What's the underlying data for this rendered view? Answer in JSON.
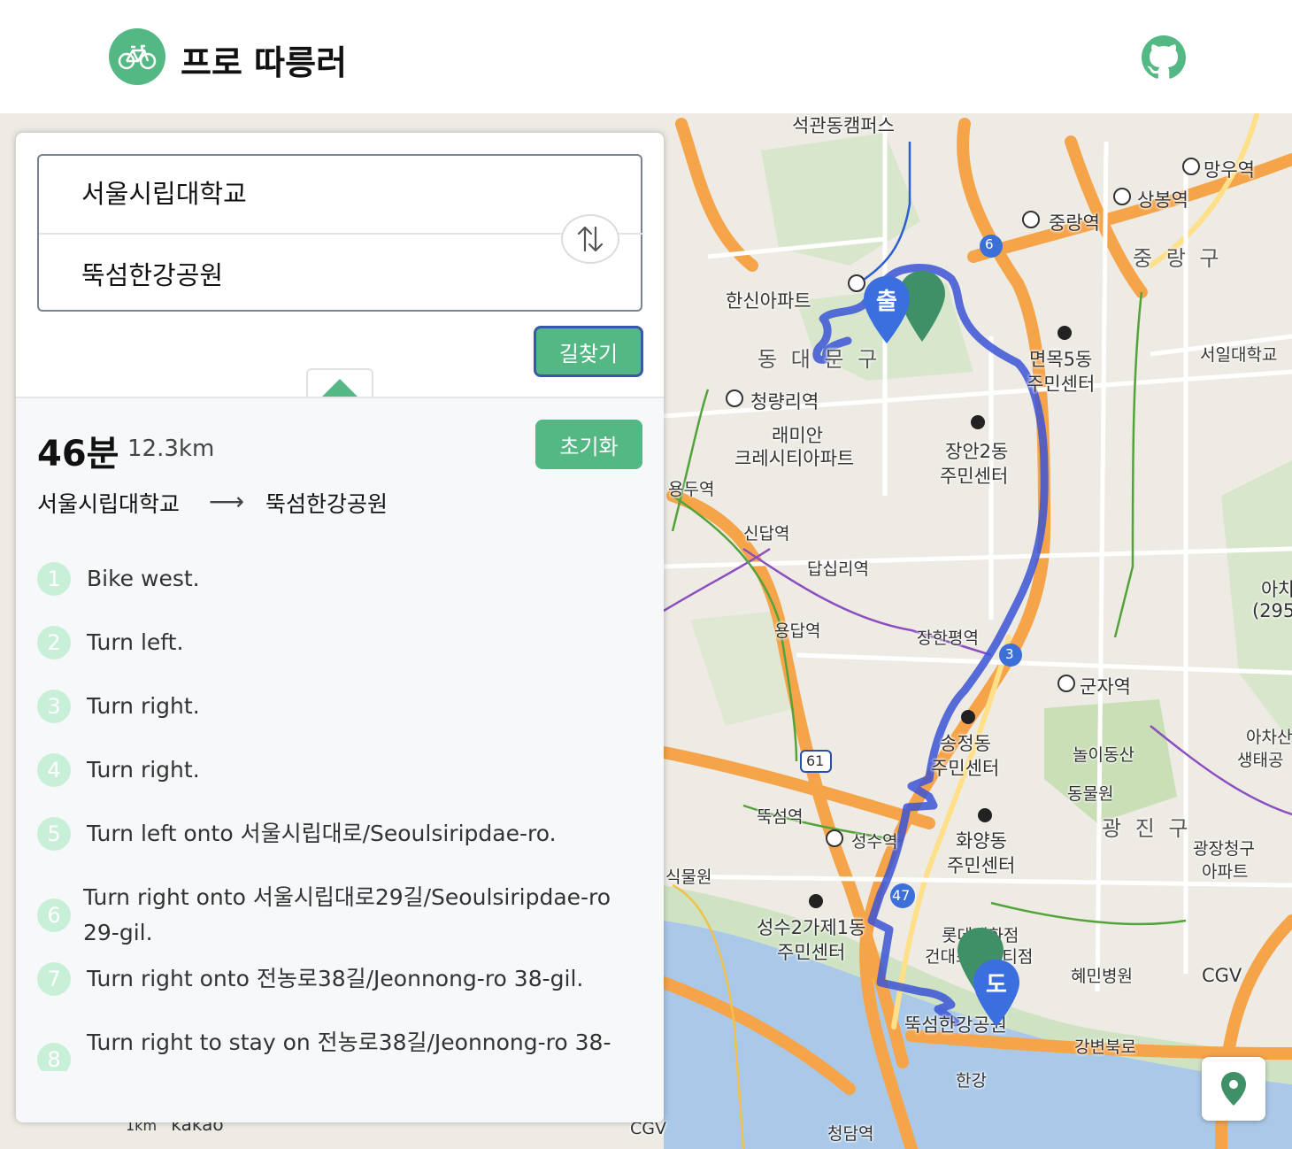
{
  "app": {
    "title": "프로 따릉러",
    "logo_icon": "bicycle-icon",
    "github_icon": "github-icon",
    "brand_color": "#54b884"
  },
  "search": {
    "origin": "서울시립대학교",
    "destination": "뚝섬한강공원",
    "swap_icon": "swap-vertical-icon",
    "search_label": "길찾기",
    "collapse_icon": "triangle-up-icon"
  },
  "result": {
    "duration": "46분",
    "distance": "12.3km",
    "reset_label": "초기화",
    "from": "서울시립대학교",
    "arrow": "⟶",
    "to": "뚝섬한강공원",
    "steps": [
      {
        "num": "1",
        "text": "Bike west."
      },
      {
        "num": "2",
        "text": "Turn left."
      },
      {
        "num": "3",
        "text": "Turn right."
      },
      {
        "num": "4",
        "text": "Turn right."
      },
      {
        "num": "5",
        "text": "Turn left onto 서울시립대로/Seoulsiripdae-ro."
      },
      {
        "num": "6",
        "text": "Turn right onto 서울시립대로29길/Seoulsiripdae-ro 29-gil."
      },
      {
        "num": "7",
        "text": "Turn right onto 전농로38길/Jeonnong-ro 38-gil."
      },
      {
        "num": "8",
        "text": "Turn right to stay on 전농로38길/Jeonnong-ro 38-"
      }
    ]
  },
  "map": {
    "start_marker": "출",
    "end_marker": "도",
    "route_color": "#3b55d6",
    "labels": {
      "l1": "석관동캠퍼스",
      "l2": "망우역",
      "l3": "상봉역",
      "l4": "중랑역",
      "l5": "중 랑 구",
      "l6": "한신아파트",
      "l7": "면목5동",
      "l8": "주민센터",
      "l9": "서일대학교",
      "l10": "청량리역",
      "l11": "래미안",
      "l12": "크레시티아파트",
      "l13": "장안2동",
      "l14": "주민센터",
      "l15": "동 대 문 구",
      "l16": "장한평역",
      "l17": "군자역",
      "l18": "아차",
      "l19": "(295",
      "l20": "송정동",
      "l21": "주민센터",
      "l22": "놀이동산",
      "l23": "동물원",
      "l24": "광 진 구",
      "l25": "아차산",
      "l26": "생태공",
      "l27": "화양동",
      "l28": "주민센터",
      "l29": "광장청구",
      "l30": "아파트",
      "l31": "성수2가제1동",
      "l32": "주민센터",
      "l33": "롯데백화점",
      "l34": "건대스타시티점",
      "l35": "혜민병원",
      "l36": "CGV",
      "l37": "뚝섬한강공원",
      "l38": "강변북로",
      "l39": "성수역",
      "l40": "뚝섬역",
      "l41": "답십리역",
      "l42": "신답역",
      "l43": "용답역",
      "l44": "용두역",
      "l45": "식물원",
      "l46": "한강",
      "l47": "청담역",
      "l48": "CGV",
      "l49": "6",
      "l50": "3",
      "l51": "47",
      "l52": "61",
      "l53": "1km",
      "l54": "kakao"
    },
    "location_icon": "map-pin-icon"
  }
}
